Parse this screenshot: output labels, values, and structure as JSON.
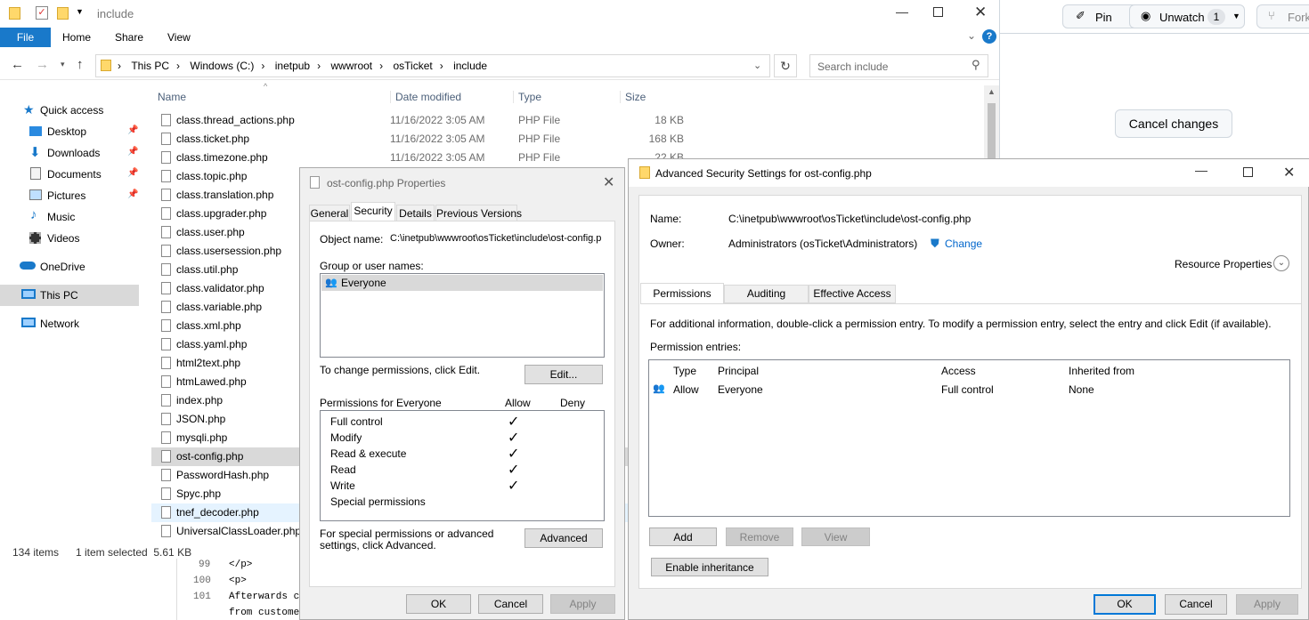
{
  "explorer": {
    "title": "include",
    "ribbon_tabs": [
      "File",
      "Home",
      "Share",
      "View"
    ],
    "breadcrumb": [
      "This PC",
      "Windows (C:)",
      "inetpub",
      "wwwroot",
      "osTicket",
      "include"
    ],
    "search_placeholder": "Search include",
    "columns": [
      "Name",
      "Date modified",
      "Type",
      "Size"
    ],
    "nav": [
      "Quick access",
      "Desktop",
      "Downloads",
      "Documents",
      "Pictures",
      "Music",
      "Videos",
      "OneDrive",
      "This PC",
      "Network"
    ],
    "files": [
      {
        "name": "class.thread_actions.php",
        "date": "11/16/2022 3:05 AM",
        "type": "PHP File",
        "size": "18 KB"
      },
      {
        "name": "class.ticket.php",
        "date": "11/16/2022 3:05 AM",
        "type": "PHP File",
        "size": "168 KB"
      },
      {
        "name": "class.timezone.php",
        "date": "11/16/2022 3:05 AM",
        "type": "PHP File",
        "size": "22 KB"
      },
      {
        "name": "class.topic.php",
        "date": "",
        "type": "",
        "size": ""
      },
      {
        "name": "class.translation.php",
        "date": "",
        "type": "",
        "size": ""
      },
      {
        "name": "class.upgrader.php",
        "date": "",
        "type": "",
        "size": ""
      },
      {
        "name": "class.user.php",
        "date": "",
        "type": "",
        "size": ""
      },
      {
        "name": "class.usersession.php",
        "date": "",
        "type": "",
        "size": ""
      },
      {
        "name": "class.util.php",
        "date": "",
        "type": "",
        "size": ""
      },
      {
        "name": "class.validator.php",
        "date": "",
        "type": "",
        "size": ""
      },
      {
        "name": "class.variable.php",
        "date": "",
        "type": "",
        "size": ""
      },
      {
        "name": "class.xml.php",
        "date": "",
        "type": "",
        "size": ""
      },
      {
        "name": "class.yaml.php",
        "date": "",
        "type": "",
        "size": ""
      },
      {
        "name": "html2text.php",
        "date": "",
        "type": "",
        "size": ""
      },
      {
        "name": "htmLawed.php",
        "date": "",
        "type": "",
        "size": ""
      },
      {
        "name": "index.php",
        "date": "",
        "type": "",
        "size": ""
      },
      {
        "name": "JSON.php",
        "date": "",
        "type": "",
        "size": ""
      },
      {
        "name": "mysqli.php",
        "date": "",
        "type": "",
        "size": ""
      },
      {
        "name": "ost-config.php",
        "date": "",
        "type": "",
        "size": ""
      },
      {
        "name": "PasswordHash.php",
        "date": "",
        "type": "",
        "size": ""
      },
      {
        "name": "Spyc.php",
        "date": "",
        "type": "",
        "size": ""
      },
      {
        "name": "tnef_decoder.php",
        "date": "",
        "type": "",
        "size": ""
      },
      {
        "name": "UniversalClassLoader.php",
        "date": "",
        "type": "",
        "size": ""
      }
    ],
    "status_items": "134 items",
    "status_selected": "1 item selected  5.61 KB"
  },
  "github": {
    "pin": "Pin",
    "unwatch": "Unwatch",
    "watch_count": "1",
    "fork": "Fork",
    "cancel_changes": "Cancel changes"
  },
  "code": {
    "lines": [
      {
        "num": "99",
        "text": "</p>"
      },
      {
        "num": "100",
        "text": "<p>"
      },
      {
        "num": "101",
        "text": "Afterwards c"
      },
      {
        "num": "",
        "text": "from custome"
      }
    ]
  },
  "props": {
    "title": "ost-config.php Properties",
    "tabs": [
      "General",
      "Security",
      "Details",
      "Previous Versions"
    ],
    "object_label": "Object name:",
    "object_value": "C:\\inetpub\\wwwroot\\osTicket\\include\\ost-config.p",
    "group_label": "Group or user names:",
    "group_entry": "Everyone",
    "change_text": "To change permissions, click Edit.",
    "edit": "Edit...",
    "perms_for": "Permissions for Everyone",
    "allow": "Allow",
    "deny": "Deny",
    "perms": [
      {
        "name": "Full control",
        "allow": "✓"
      },
      {
        "name": "Modify",
        "allow": "✓"
      },
      {
        "name": "Read & execute",
        "allow": "✓"
      },
      {
        "name": "Read",
        "allow": "✓"
      },
      {
        "name": "Write",
        "allow": "✓"
      },
      {
        "name": "Special permissions",
        "allow": ""
      }
    ],
    "special_text": "For special permissions or advanced settings, click Advanced.",
    "advanced": "Advanced",
    "ok": "OK",
    "cancel": "Cancel",
    "apply": "Apply"
  },
  "adv": {
    "title": "Advanced Security Settings for ost-config.php",
    "name_label": "Name:",
    "name_value": "C:\\inetpub\\wwwroot\\osTicket\\include\\ost-config.php",
    "owner_label": "Owner:",
    "owner_value": "Administrators (osTicket\\Administrators)",
    "change": "Change",
    "resource": "Resource Properties",
    "tabs": [
      "Permissions",
      "Auditing",
      "Effective Access"
    ],
    "info": "For additional information, double-click a permission entry. To modify a permission entry, select the entry and click Edit (if available).",
    "entries_label": "Permission entries:",
    "columns": [
      "Type",
      "Principal",
      "Access",
      "Inherited from"
    ],
    "row": {
      "type": "Allow",
      "principal": "Everyone",
      "access": "Full control",
      "inherited": "None"
    },
    "add": "Add",
    "remove": "Remove",
    "view": "View",
    "enable_inheritance": "Enable inheritance",
    "ok": "OK",
    "cancel": "Cancel",
    "apply": "Apply"
  },
  "colors": {
    "accent": "#0078d7",
    "file_tab": "#1979ca",
    "link": "#0066cc"
  }
}
